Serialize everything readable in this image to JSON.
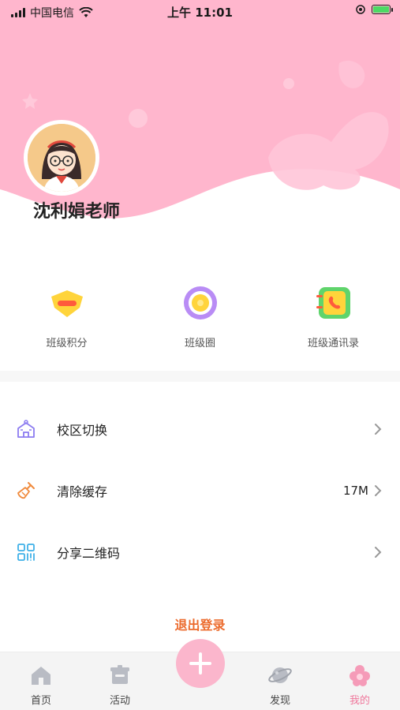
{
  "status_bar": {
    "carrier": "中国电信",
    "time": "上午 11:01"
  },
  "profile": {
    "name": "沈利娟老师"
  },
  "quick_actions": [
    {
      "label": "班级积分",
      "icon": "class-points-icon"
    },
    {
      "label": "班级圈",
      "icon": "class-circle-icon"
    },
    {
      "label": "班级通讯录",
      "icon": "contacts-book-icon"
    }
  ],
  "menu": [
    {
      "label": "校区切换",
      "value": "",
      "icon": "campus-icon"
    },
    {
      "label": "清除缓存",
      "value": "17M",
      "icon": "broom-icon"
    },
    {
      "label": "分享二维码",
      "value": "",
      "icon": "qrcode-icon"
    }
  ],
  "logout_label": "退出登录",
  "tabs": [
    {
      "label": "首页",
      "icon": "home-icon"
    },
    {
      "label": "活动",
      "icon": "activity-icon"
    },
    {
      "label": "发现",
      "icon": "planet-icon"
    },
    {
      "label": "我的",
      "icon": "flower-icon",
      "active": true
    }
  ],
  "colors": {
    "header_pink": "#ffb5cc",
    "accent_orange": "#ec6b2d",
    "tab_active": "#f0789c"
  }
}
